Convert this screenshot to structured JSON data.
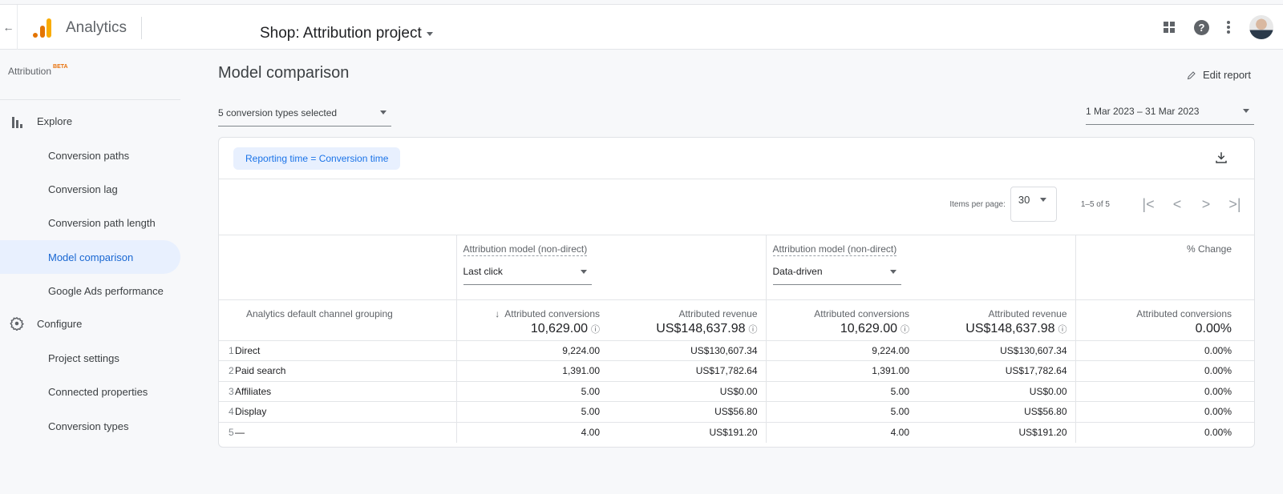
{
  "topbar": {
    "back_icon": "arrow-left-icon",
    "logo_icon": "analytics-logo-icon",
    "app_name": "Analytics",
    "property": "Shop: Attribution project",
    "icons": [
      "apps-grid-icon",
      "help-icon",
      "more-vert-icon",
      "avatar"
    ],
    "help_glyph": "?"
  },
  "sidebar": {
    "title": "Attribution",
    "badge": "BETA",
    "sections": [
      {
        "label": "Explore",
        "icon": "bar-chart-icon",
        "items": [
          {
            "label": "Conversion paths",
            "active": false
          },
          {
            "label": "Conversion lag",
            "active": false
          },
          {
            "label": "Conversion path length",
            "active": false
          },
          {
            "label": "Model comparison",
            "active": true
          },
          {
            "label": "Google Ads performance",
            "active": false
          }
        ]
      },
      {
        "label": "Configure",
        "icon": "gear-icon",
        "items": [
          {
            "label": "Project settings",
            "active": false
          },
          {
            "label": "Connected properties",
            "active": false
          },
          {
            "label": "Conversion types",
            "active": false
          }
        ]
      }
    ]
  },
  "main": {
    "title": "Model comparison",
    "edit_report": "Edit report",
    "conversion_select": "5 conversion types selected",
    "date_range": "1 Mar 2023 – 31 Mar 2023",
    "filter_chip": "Reporting time = Conversion time",
    "pager": {
      "items_per_page_label": "Items per page:",
      "items_per_page": "30",
      "range": "1–5 of 5",
      "first": "|<",
      "prev": "<",
      "next": ">",
      "last": ">|"
    },
    "table": {
      "model_label": "Attribution model (non-direct)",
      "model_a": "Last click",
      "model_b": "Data-driven",
      "pct_change_label": "% Change",
      "dimension_header": "Analytics default channel grouping",
      "sort_arrow": "↓",
      "info_glyph": "ⓘ",
      "columns": [
        "Attributed conversions",
        "Attributed revenue",
        "Attributed conversions",
        "Attributed revenue",
        "Attributed conversions"
      ],
      "totals": [
        "10,629.00",
        "US$148,637.98",
        "10,629.00",
        "US$148,637.98",
        "0.00%"
      ],
      "rows": [
        {
          "index": "1",
          "channel": "Direct",
          "a_conv": "9,224.00",
          "a_rev": "US$130,607.34",
          "b_conv": "9,224.00",
          "b_rev": "US$130,607.34",
          "pct": "0.00%"
        },
        {
          "index": "2",
          "channel": "Paid search",
          "a_conv": "1,391.00",
          "a_rev": "US$17,782.64",
          "b_conv": "1,391.00",
          "b_rev": "US$17,782.64",
          "pct": "0.00%"
        },
        {
          "index": "3",
          "channel": "Affiliates",
          "a_conv": "5.00",
          "a_rev": "US$0.00",
          "b_conv": "5.00",
          "b_rev": "US$0.00",
          "pct": "0.00%"
        },
        {
          "index": "4",
          "channel": "Display",
          "a_conv": "5.00",
          "a_rev": "US$56.80",
          "b_conv": "5.00",
          "b_rev": "US$56.80",
          "pct": "0.00%"
        },
        {
          "index": "5",
          "channel": "—",
          "a_conv": "4.00",
          "a_rev": "US$191.20",
          "b_conv": "4.00",
          "b_rev": "US$191.20",
          "pct": "0.00%"
        }
      ]
    }
  },
  "colors": {
    "accent": "#1a73e8",
    "active_nav_bg": "#e8f0fe",
    "beta": "#e8710a",
    "logo_light": "#f9ab00",
    "logo_dark": "#e37400"
  }
}
